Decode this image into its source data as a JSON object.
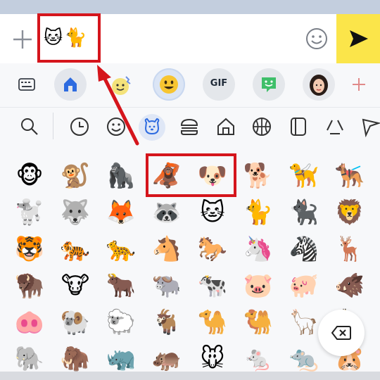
{
  "input": {
    "typed_emojis": "🐱🐈"
  },
  "tabs": [
    {
      "name": "keyboard-icon"
    },
    {
      "name": "home-icon"
    },
    {
      "name": "sticker-icon"
    },
    {
      "name": "emoji-face-icon"
    },
    {
      "name": "gif",
      "label": "GIF"
    },
    {
      "name": "bitmoji-icon"
    },
    {
      "name": "avatar-icon"
    },
    {
      "name": "plus-icon"
    }
  ],
  "categories": [
    "search-icon",
    "recent-clock-icon",
    "smiley-icon",
    "animals-dog-icon",
    "food-burger-icon",
    "places-house-icon",
    "activity-ball-icon",
    "objects-icon",
    "symbols-icon",
    "flags-icon"
  ],
  "emoji_rows": [
    [
      "🐵",
      "🐒",
      "🦍",
      "🦧",
      "🐶",
      "🐕",
      "🦮",
      "🐕‍🦺"
    ],
    [
      "🐩",
      "🐺",
      "🦊",
      "🦝",
      "🐱",
      "🐈",
      "🐈‍⬛",
      "🦁"
    ],
    [
      "🐯",
      "🐅",
      "🐆",
      "🐴",
      "🐎",
      "🦄",
      "🦓",
      "🦌"
    ],
    [
      "🦬",
      "🐮",
      "🐂",
      "🐃",
      "🐄",
      "🐷",
      "🐖",
      "🐗"
    ],
    [
      "🐽",
      "🐏",
      "🐑",
      "🐐",
      "🐪",
      "🐫",
      "🦙",
      "🦒"
    ],
    [
      "🐘",
      "🦣",
      "🦏",
      "🦛",
      "🐭",
      "🐁",
      "🐀",
      "🐹"
    ]
  ],
  "colors": {
    "highlight": "#d5151c",
    "send": "#fbe54a",
    "accent": "#2d6be0"
  }
}
